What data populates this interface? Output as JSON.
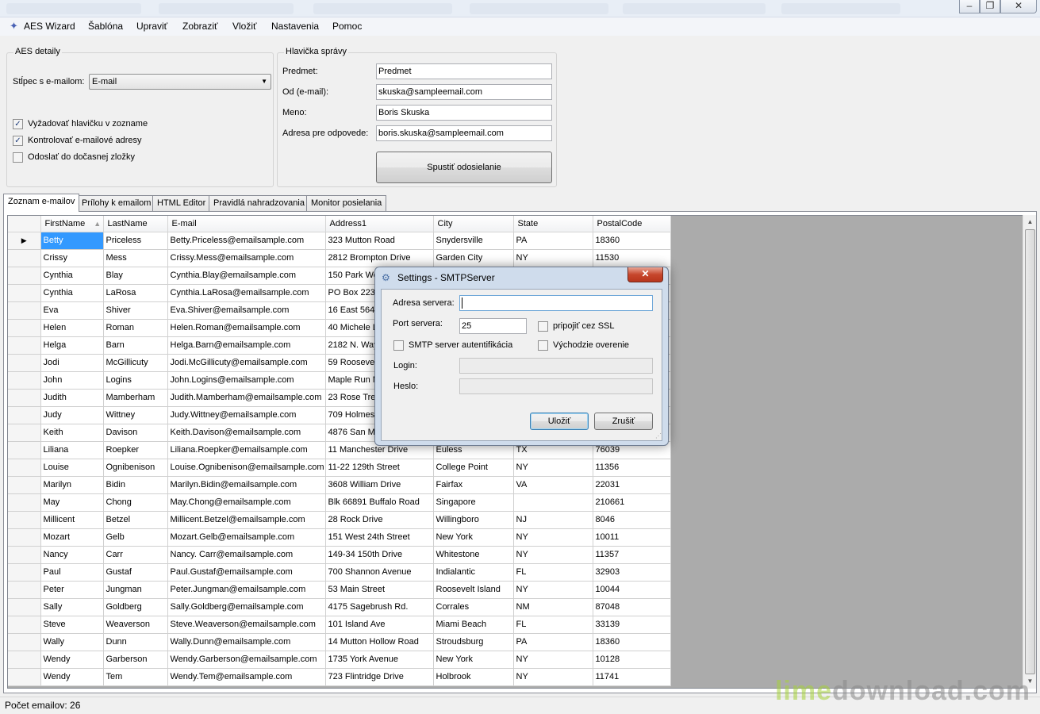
{
  "menu": {
    "items": [
      "AES Wizard",
      "Šablóna",
      "Upraviť",
      "Zobraziť",
      "Vložiť",
      "Nastavenia",
      "Pomoc"
    ]
  },
  "aes_details": {
    "title": "AES detaily",
    "email_column_label": "Stĺpec s e-mailom:",
    "email_column_value": "E-mail",
    "checkboxes": [
      {
        "label": "Vyžadovať hlavičku v zozname",
        "checked": true
      },
      {
        "label": "Kontrolovať e-mailové adresy",
        "checked": true
      },
      {
        "label": "Odoslať do dočasnej zložky",
        "checked": false
      }
    ]
  },
  "message_header": {
    "title": "Hlavička správy",
    "subject_label": "Predmet:",
    "subject_value": "Predmet",
    "from_label": "Od (e-mail):",
    "from_value": "skuska@sampleemail.com",
    "name_label": "Meno:",
    "name_value": "Boris Skuska",
    "reply_label": "Adresa pre odpovede:",
    "reply_value": "boris.skuska@sampleemail.com",
    "send_button": "Spustiť odosielanie"
  },
  "tabs": [
    "Zoznam e-mailov",
    "Prílohy k emailom",
    "HTML Editor",
    "Pravidlá nahradzovania",
    "Monitor posielania"
  ],
  "grid": {
    "columns": [
      "FirstName",
      "LastName",
      "E-mail",
      "Address1",
      "City",
      "State",
      "PostalCode"
    ],
    "rows": [
      [
        "Betty",
        "Priceless",
        "Betty.Priceless@emailsample.com",
        "323 Mutton  Road",
        "Snydersville",
        "PA",
        "18360"
      ],
      [
        "Crissy",
        "Mess",
        "Crissy.Mess@emailsample.com",
        "2812 Brompton Drive",
        "Garden City",
        "NY",
        "11530"
      ],
      [
        "Cynthia",
        "Blay",
        "Cynthia.Blay@emailsample.com",
        "150  Park West",
        "",
        "",
        ""
      ],
      [
        "Cynthia",
        "LaRosa",
        "Cynthia.LaRosa@emailsample.com",
        "PO Box 223",
        "",
        "",
        ""
      ],
      [
        "Eva",
        "Shiver",
        "Eva.Shiver@emailsample.com",
        "16 East 564th",
        "",
        "",
        ""
      ],
      [
        "Helen",
        "Roman",
        "Helen.Roman@emailsample.com",
        "40 Michele La",
        "",
        "",
        ""
      ],
      [
        "Helga",
        "Barn",
        "Helga.Barn@emailsample.com",
        "2182 N.  Way",
        "",
        "",
        ""
      ],
      [
        "Jodi",
        "McGillicuty",
        "Jodi.McGillicuty@emailsample.com",
        "59 Roosevelt",
        "",
        "",
        ""
      ],
      [
        "John",
        "Logins",
        "John.Logins@emailsample.com",
        "Maple Run Ma",
        "",
        "",
        ""
      ],
      [
        "Judith",
        "Mamberham",
        "Judith.Mamberham@emailsample.com",
        "23 Rose Tree",
        "",
        "",
        ""
      ],
      [
        "Judy",
        "Wittney",
        "Judy.Wittney@emailsample.com",
        "709 Holmes R",
        "",
        "",
        ""
      ],
      [
        "Keith",
        "Davison",
        "Keith.Davison@emailsample.com",
        "4876 San Mar",
        "",
        "",
        ""
      ],
      [
        "Liliana",
        "Roepker",
        "Liliana.Roepker@emailsample.com",
        "11 Manchester Drive",
        "Euless",
        "TX",
        "76039"
      ],
      [
        "Louise",
        "Ognibenison",
        "Louise.Ognibenison@emailsample.com",
        "11-22 129th Street",
        "College Point",
        "NY",
        "11356"
      ],
      [
        "Marilyn",
        "Bidin",
        "Marilyn.Bidin@emailsample.com",
        "3608  William Drive",
        "Fairfax",
        "VA",
        "22031"
      ],
      [
        "May",
        "Chong",
        "May.Chong@emailsample.com",
        "Blk 66891 Buffalo Road",
        "Singapore",
        "",
        "210661"
      ],
      [
        "Millicent",
        "Betzel",
        "Millicent.Betzel@emailsample.com",
        "28 Rock Drive",
        "Willingboro",
        "NJ",
        "8046"
      ],
      [
        "Mozart",
        "Gelb",
        "Mozart.Gelb@emailsample.com",
        "151 West 24th Street",
        "New York",
        "NY",
        "10011"
      ],
      [
        "Nancy",
        " Carr",
        "Nancy. Carr@emailsample.com",
        "149-34 150th Drive",
        "Whitestone",
        "NY",
        "11357"
      ],
      [
        "Paul",
        "Gustaf",
        "Paul.Gustaf@emailsample.com",
        "700  Shannon Avenue",
        "Indialantic",
        "FL",
        "32903"
      ],
      [
        "Peter",
        "Jungman",
        "Peter.Jungman@emailsample.com",
        "53 Main Street",
        "Roosevelt Island",
        "NY",
        "10044"
      ],
      [
        "Sally",
        "Goldberg",
        "Sally.Goldberg@emailsample.com",
        "4175 Sagebrush Rd.",
        "Corrales",
        "NM",
        "87048"
      ],
      [
        "Steve",
        "Weaverson",
        "Steve.Weaverson@emailsample.com",
        "101 Island Ave",
        "Miami Beach",
        "FL",
        "33139"
      ],
      [
        "Wally",
        "Dunn",
        "Wally.Dunn@emailsample.com",
        "14 Mutton Hollow Road",
        "Stroudsburg",
        "PA",
        "18360"
      ],
      [
        "Wendy",
        "Garberson",
        "Wendy.Garberson@emailsample.com",
        "1735 York Avenue",
        "New York",
        "NY",
        "10128"
      ],
      [
        "Wendy",
        "Tem",
        "Wendy.Tem@emailsample.com",
        "723 Flintridge Drive",
        "Holbrook",
        "NY",
        "11741"
      ]
    ]
  },
  "status": {
    "count_text": "Počet emailov: 26"
  },
  "watermark": {
    "part1": "lime",
    "part2": "download.com"
  },
  "dialog": {
    "title": "Settings - SMTPServer",
    "close_glyph": "✕",
    "server_label": "Adresa servera:",
    "server_value": "",
    "port_label": "Port servera:",
    "port_value": "25",
    "ssl_label": "pripojiť cez SSL",
    "auth_label": "SMTP server autentifikácia",
    "default_auth_label": "Východzie overenie",
    "login_label": "Login:",
    "password_label": "Heslo:",
    "save_button": "Uložiť",
    "cancel_button": "Zrušiť"
  },
  "colors": {
    "selection": "#3399ff",
    "close_button": "#c7472d",
    "grid_background": "#ababab"
  }
}
